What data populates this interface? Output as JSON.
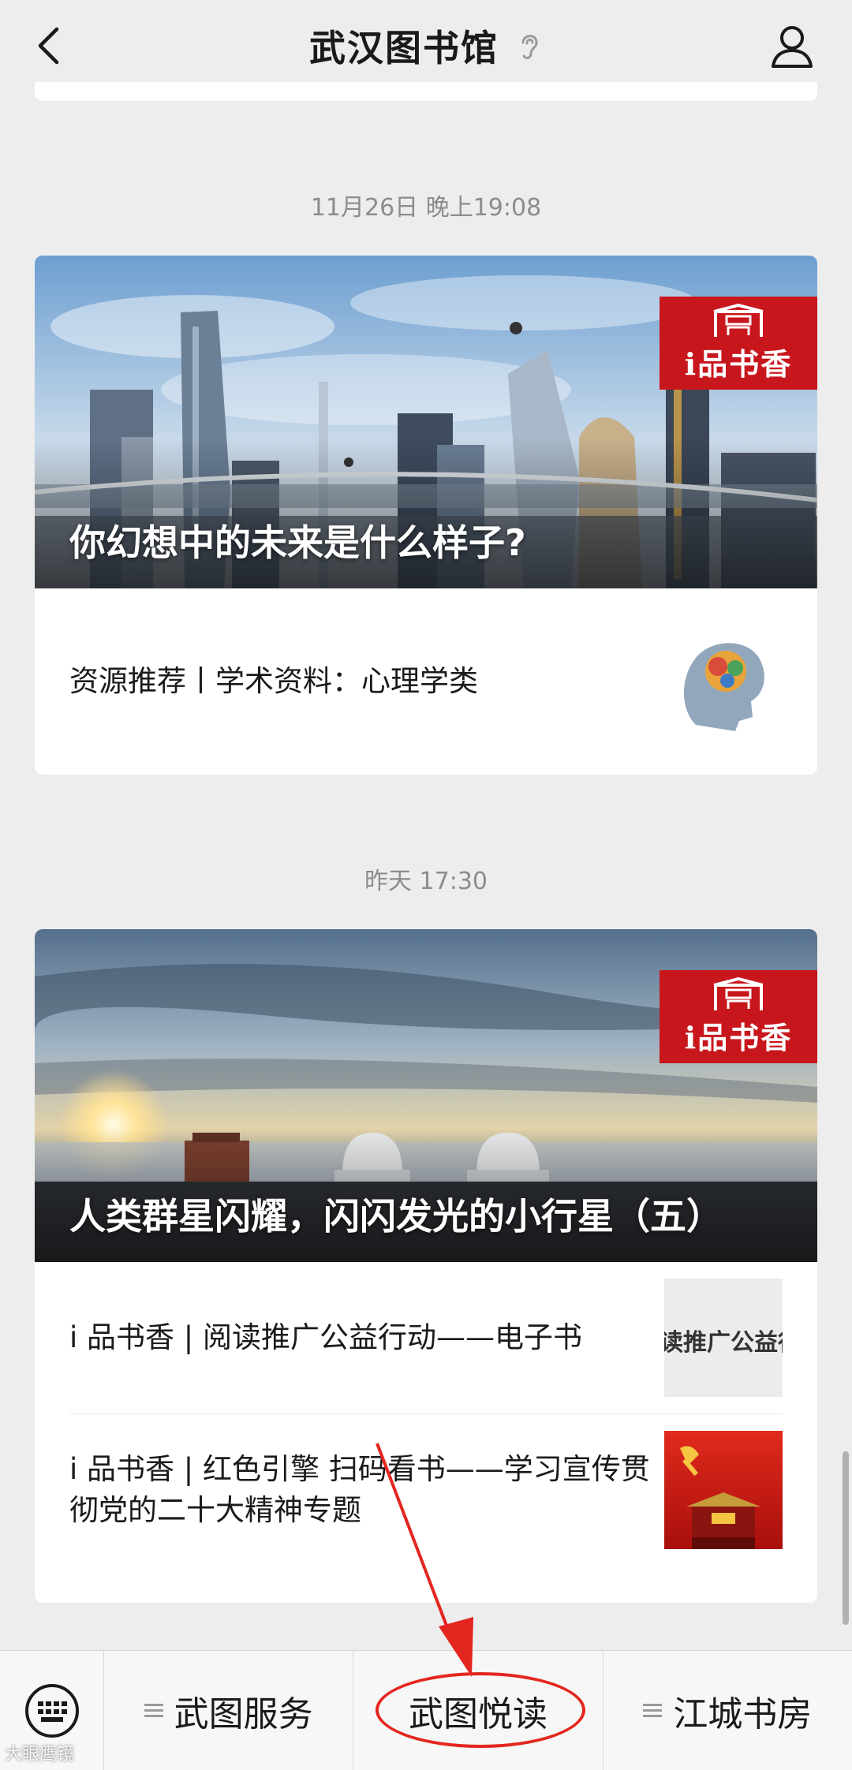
{
  "header": {
    "title": "武汉图书馆",
    "back_icon": "back-chevron-icon",
    "ear_icon": "ear-icon",
    "profile_icon": "user-icon"
  },
  "messages": [
    {
      "time": "11月26日 晚上19:08",
      "cover_title": "你幻想中的未来是什么样子?",
      "badge": "i品书香",
      "sub_items": [
        {
          "title": "资源推荐丨学术资料：心理学类"
        }
      ]
    },
    {
      "time": "昨天 17:30",
      "cover_title": "人类群星闪耀，闪闪发光的小行星（五）",
      "badge": "i品书香",
      "sub_items": [
        {
          "title": "i 品书香 | 阅读推广公益行动——电子书",
          "thumb_text": "读推广公益行"
        },
        {
          "title": "i 品书香 | 红色引擎 扫码看书——学习宣传贯彻党的二十大精神专题"
        }
      ]
    }
  ],
  "bottom_menu": {
    "keyboard_icon": "keyboard-icon",
    "items": [
      {
        "label": "武图服务"
      },
      {
        "label": "武图悦读"
      },
      {
        "label": "江城书房"
      }
    ]
  },
  "watermark": "大眼鹰镜",
  "colors": {
    "badge_red": "#c8161d",
    "annotation_red": "#e3261f",
    "background": "#ededed"
  }
}
